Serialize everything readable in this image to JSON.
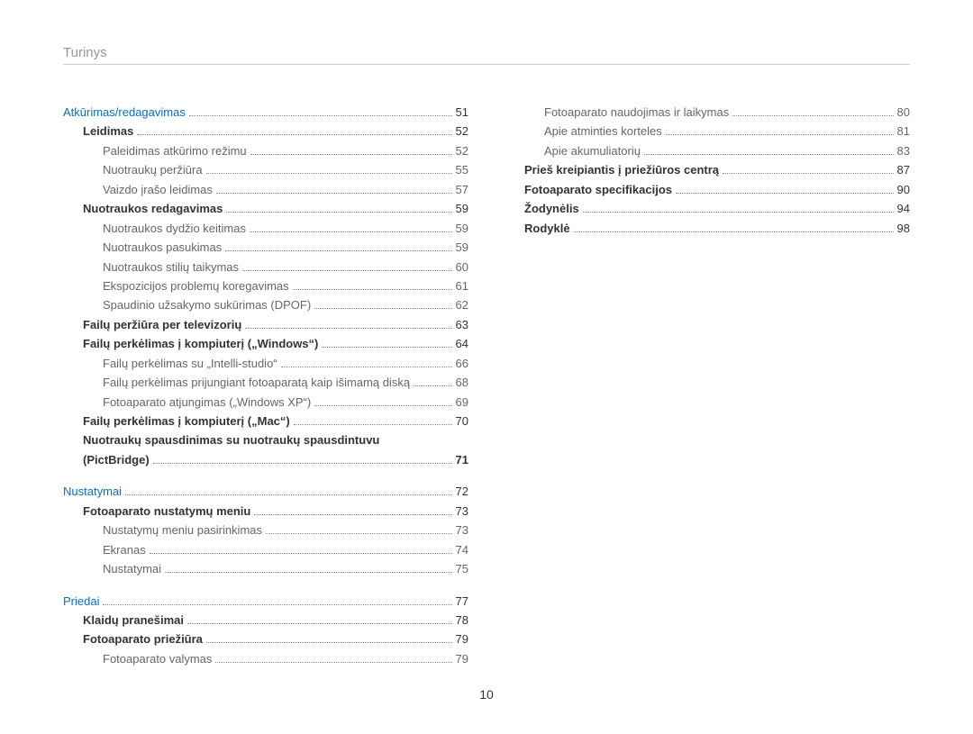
{
  "title": "Turinys",
  "page_number": "10",
  "left": [
    {
      "kind": "chapter",
      "label": "Atkūrimas/redagavimas",
      "page": "51"
    },
    {
      "kind": "section",
      "label": "Leidimas",
      "page": "52"
    },
    {
      "kind": "subsection",
      "label": "Paleidimas atkūrimo režimu",
      "page": "52"
    },
    {
      "kind": "subsection",
      "label": "Nuotraukų peržiūra",
      "page": "55"
    },
    {
      "kind": "subsection",
      "label": "Vaizdo įrašo leidimas",
      "page": "57"
    },
    {
      "kind": "section",
      "label": "Nuotraukos redagavimas",
      "page": "59"
    },
    {
      "kind": "subsection",
      "label": "Nuotraukos dydžio keitimas",
      "page": "59"
    },
    {
      "kind": "subsection",
      "label": "Nuotraukos pasukimas",
      "page": "59"
    },
    {
      "kind": "subsection",
      "label": "Nuotraukos stilių taikymas",
      "page": "60"
    },
    {
      "kind": "subsection",
      "label": "Ekspozicijos problemų koregavimas",
      "page": "61"
    },
    {
      "kind": "subsection",
      "label": "Spaudinio užsakymo sukūrimas (DPOF)",
      "page": "62"
    },
    {
      "kind": "section",
      "label": "Failų peržiūra per televizorių",
      "page": "63"
    },
    {
      "kind": "section",
      "label": "Failų perkėlimas į kompiuterį („Windows“)",
      "page": "64"
    },
    {
      "kind": "subsection",
      "label": "Failų perkėlimas su „Intelli-studio“",
      "page": "66"
    },
    {
      "kind": "subsection",
      "label": "Failų perkėlimas prijungiant fotoaparatą kaip išimamą diską",
      "page": "68"
    },
    {
      "kind": "subsection",
      "label": "Fotoaparato atjungimas („Windows XP“)",
      "page": "69"
    },
    {
      "kind": "section",
      "label": "Failų perkėlimas į kompiuterį („Mac“)",
      "page": "70"
    },
    {
      "kind": "section",
      "label": "Nuotraukų spausdinimas su nuotraukų spausdintuvu (PictBridge)",
      "page": "71",
      "wrapped": true
    },
    {
      "kind": "spacer"
    },
    {
      "kind": "chapter",
      "label": "Nustatymai",
      "page": "72"
    },
    {
      "kind": "section",
      "label": "Fotoaparato nustatymų meniu",
      "page": "73"
    },
    {
      "kind": "subsection",
      "label": "Nustatymų meniu pasirinkimas",
      "page": "73"
    },
    {
      "kind": "subsection",
      "label": "Ekranas",
      "page": "74"
    },
    {
      "kind": "subsection",
      "label": "Nustatymai",
      "page": "75"
    },
    {
      "kind": "spacer"
    },
    {
      "kind": "chapter",
      "label": "Priedai",
      "page": "77"
    },
    {
      "kind": "section",
      "label": "Klaidų pranešimai",
      "page": "78"
    },
    {
      "kind": "section",
      "label": "Fotoaparato priežiūra",
      "page": "79"
    },
    {
      "kind": "subsection",
      "label": "Fotoaparato valymas",
      "page": "79"
    }
  ],
  "right": [
    {
      "kind": "subsection",
      "label": "Fotoaparato naudojimas ir laikymas",
      "page": "80"
    },
    {
      "kind": "subsection",
      "label": "Apie atminties korteles",
      "page": "81"
    },
    {
      "kind": "subsection",
      "label": "Apie akumuliatorių",
      "page": "83"
    },
    {
      "kind": "section",
      "label": "Prieš kreipiantis į priežiūros centrą",
      "page": "87"
    },
    {
      "kind": "section",
      "label": "Fotoaparato specifikacijos",
      "page": "90"
    },
    {
      "kind": "section",
      "label": "Žodynėlis",
      "page": "94"
    },
    {
      "kind": "section",
      "label": "Rodyklė",
      "page": "98"
    }
  ]
}
